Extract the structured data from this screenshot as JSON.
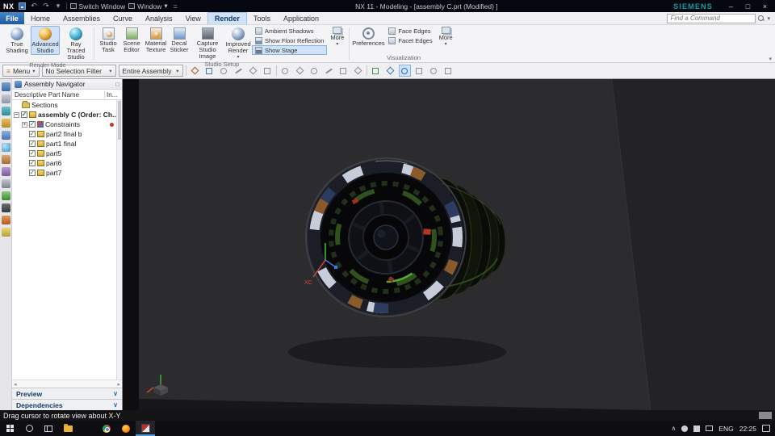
{
  "icons": {
    "dropdown": "▾",
    "chevron": "∨",
    "chevron_up": "∧",
    "left_arrow": "◂",
    "right_arrow": "▸",
    "check": "✓",
    "plus": "+",
    "minus": "−",
    "menu_lines": "≡",
    "close": "×",
    "maximize": "□",
    "minimize": "–",
    "undo": "↶",
    "redo": "↷",
    "equals": "="
  },
  "titlebar": {
    "logo": "NX",
    "switch_window": "Switch Window",
    "window_menu": "Window",
    "title": "NX 11 - Modeling - [assembly C.prt (Modified) ]",
    "brand": "SIEMENS"
  },
  "menubar": {
    "file_label": "File",
    "tabs": [
      {
        "label": "Home"
      },
      {
        "label": "Assemblies"
      },
      {
        "label": "Curve"
      },
      {
        "label": "Analysis"
      },
      {
        "label": "View"
      },
      {
        "label": "Render"
      },
      {
        "label": "Tools"
      },
      {
        "label": "Application"
      }
    ],
    "search_placeholder": "Find a Command"
  },
  "ribbon": {
    "render_mode": {
      "caption": "Render Mode",
      "true_shading": "True Shading",
      "advanced_studio": "Advanced Studio",
      "ray_traced": "Ray Traced Studio"
    },
    "studio_setup": {
      "caption": "Studio Setup",
      "studio_task": "Studio Task",
      "scene_editor": "Scene Editor",
      "material_texture": "Material Texture",
      "decal_sticker": "Decal Sticker",
      "capture_studio_image": "Capture Studio Image",
      "improved_render": "Improved Render",
      "ambient_shadows": "Ambient Shadows",
      "show_floor_reflection": "Show Floor Reflection",
      "show_stage": "Show Stage",
      "more": "More"
    },
    "visualization": {
      "caption": "Visualization",
      "preferences": "Preferences",
      "face_edges": "Face Edges",
      "facet_edges": "Facet Edges",
      "more": "More"
    }
  },
  "toolbar": {
    "menu_label": "Menu",
    "selection_filter": "No Selection Filter",
    "scope": "Entire Assembly"
  },
  "navigator": {
    "title": "Assembly Navigator",
    "col_name": "Descriptive Part Name",
    "col_info": "In...",
    "rows": [
      {
        "label": "Sections"
      },
      {
        "label": "assembly C (Order: Ch..."
      },
      {
        "label": "Constraints"
      },
      {
        "label": "part2 final b"
      },
      {
        "label": "part1 final"
      },
      {
        "label": "part5"
      },
      {
        "label": "part6"
      },
      {
        "label": "part7"
      }
    ],
    "preview": "Preview",
    "dependencies": "Dependencies"
  },
  "viewport": {
    "axis_label": "XC"
  },
  "statusbar": {
    "message": "Drag cursor to rotate view about X-Y"
  },
  "taskbar": {
    "lang": "ENG",
    "time": "22:25"
  }
}
